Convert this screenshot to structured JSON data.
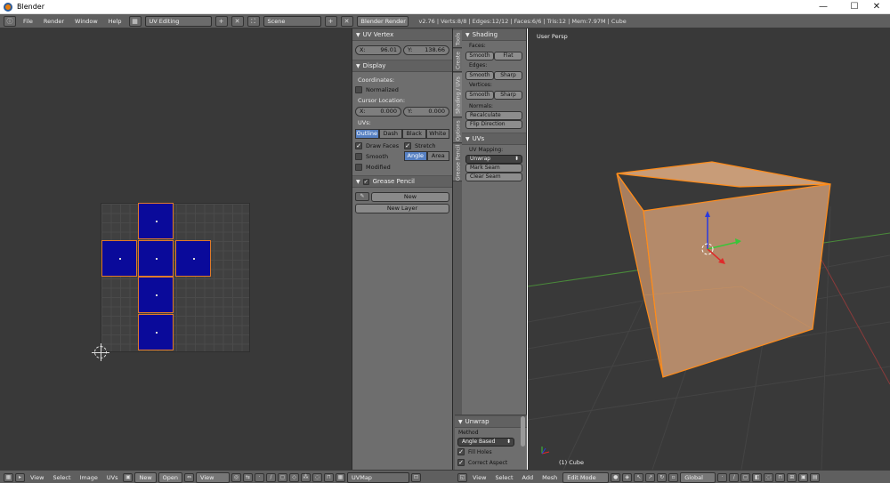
{
  "window": {
    "title": "Blender",
    "minimize": "—",
    "maximize": "☐",
    "close": "✕"
  },
  "info_header": {
    "menus": [
      "File",
      "Render",
      "Window",
      "Help"
    ],
    "layout": "UV Editing",
    "scene": "Scene",
    "engine": "Blender Render",
    "status": "v2.76 | Verts:8/8 | Edges:12/12 | Faces:6/6 | Tris:12 | Mem:7.97M | Cube"
  },
  "uv_panel": {
    "uv_vertex": {
      "title": "UV Vertex",
      "x_label": "X:",
      "x_value": "96.01",
      "y_label": "Y:",
      "y_value": "138.66"
    },
    "display": {
      "title": "Display",
      "coordinates_label": "Coordinates:",
      "normalized_label": "Normalized",
      "cursor_label": "Cursor Location:",
      "cursor_x_label": "X:",
      "cursor_x": "0.000",
      "cursor_y_label": "Y:",
      "cursor_y": "0.000",
      "uvs_label": "UVs:",
      "uv_modes": [
        "Outline",
        "Dash",
        "Black",
        "White"
      ],
      "uv_mode_selected": "Outline",
      "draw_faces": "Draw Faces",
      "stretch": "Stretch",
      "smooth": "Smooth",
      "stretch_modes": [
        "Angle",
        "Area"
      ],
      "stretch_mode_selected": "Angle",
      "modified": "Modified"
    },
    "grease_pencil": {
      "title": "Grease Pencil",
      "new": "New",
      "new_layer": "New Layer"
    }
  },
  "vertical_tabs": [
    "Tools",
    "Create",
    "Shading / UVs",
    "Options",
    "Grease Pencil"
  ],
  "tool_shelf": {
    "shading": {
      "title": "Shading",
      "faces_label": "Faces:",
      "edges_label": "Edges:",
      "vertices_label": "Vertices:",
      "smooth": "Smooth",
      "flat": "Flat",
      "sharp": "Sharp",
      "normals_label": "Normals:",
      "recalculate": "Recalculate",
      "flip_direction": "Flip Direction"
    },
    "uvs": {
      "title": "UVs",
      "mapping_label": "UV Mapping:",
      "unwrap": "Unwrap",
      "mark_seam": "Mark Seam",
      "clear_seam": "Clear Seam"
    }
  },
  "unwrap_panel": {
    "title": "Unwrap",
    "method_label": "Method",
    "method_value": "Angle Based",
    "fill_holes": "Fill Holes",
    "correct_aspect": "Correct Aspect"
  },
  "viewport": {
    "view_label": "User Persp",
    "object_label": "(1) Cube"
  },
  "uv_footer": {
    "menus": [
      "View",
      "Select",
      "Image",
      "UVs"
    ],
    "new": "New",
    "open": "Open",
    "view": "View",
    "uvmap": "UVMap"
  },
  "vp_footer": {
    "menus": [
      "View",
      "Select",
      "Add",
      "Mesh"
    ],
    "mode": "Edit Mode",
    "orientation": "Global"
  },
  "colors": {
    "uv_face": "#0a0a9a",
    "seam_orange": "#e07a2a",
    "cube_fill": "#c89c78",
    "selected_blue": "#5680c2"
  }
}
